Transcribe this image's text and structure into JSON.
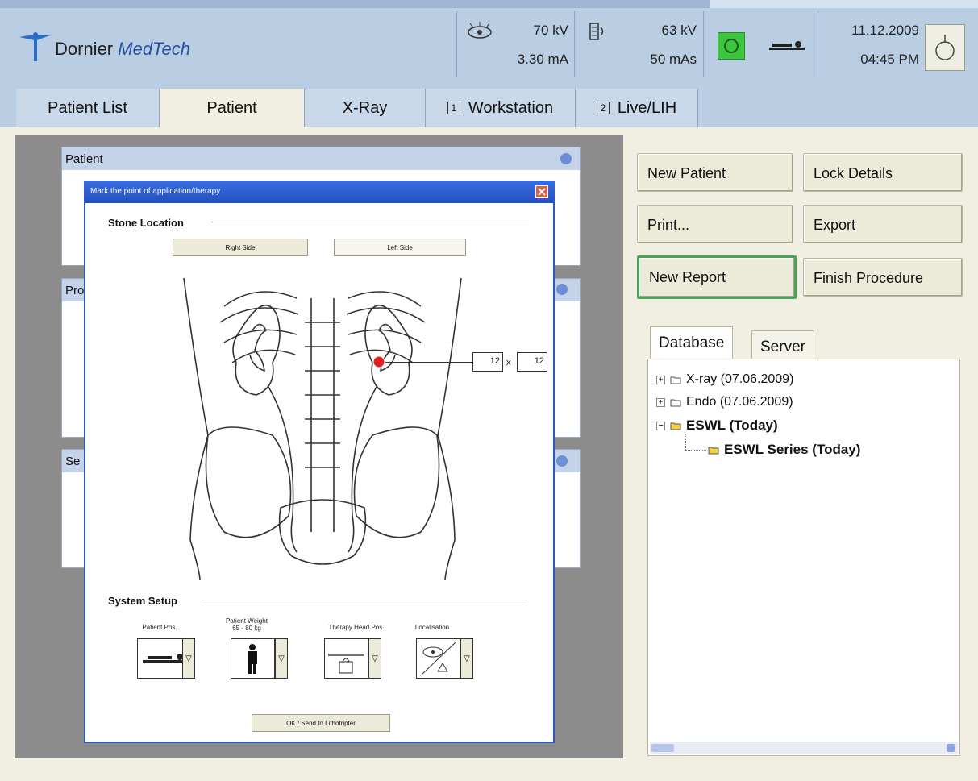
{
  "header": {
    "brand_part1": "Dornier",
    "brand_part2": "MedTech",
    "kv1": "70 kV",
    "ma": "3.30 mA",
    "kv2": "63 kV",
    "mas": "50 mAs",
    "date": "11.12.2009",
    "time": "04:45 PM"
  },
  "tabs": [
    {
      "label": "Patient List"
    },
    {
      "label": "Patient"
    },
    {
      "label": "X-Ray"
    },
    {
      "label": "Workstation",
      "num": "1"
    },
    {
      "label": "Live/LIH",
      "num": "2"
    }
  ],
  "bg_panels": {
    "patient": "Patient",
    "procedure_partial": "Pro",
    "series_partial": "Se"
  },
  "dialog": {
    "title": "Mark the point of application/therapy",
    "stone_location": "Stone Location",
    "right_side": "Right Side",
    "left_side": "Left Side",
    "size_w": "12",
    "size_x": "x",
    "size_h": "12",
    "system_setup": "System Setup",
    "patient_pos": "Patient Pos.",
    "patient_weight_line1": "Patient Weight",
    "patient_weight_line2": "65 - 80 kg",
    "therapy_head_pos": "Therapy Head Pos.",
    "localisation": "Localisation",
    "ok_button": "OK / Send to Lithotripter"
  },
  "actions": {
    "new_patient": "New Patient",
    "lock_details": "Lock Details",
    "print": "Print...",
    "export": "Export",
    "new_report": "New Report",
    "finish_procedure": "Finish Procedure"
  },
  "db_tabs": {
    "database": "Database",
    "server": "Server"
  },
  "tree": [
    {
      "label": "X-ray (07.06.2009)"
    },
    {
      "label": "Endo (07.06.2009)"
    },
    {
      "label": "ESWL (Today)"
    },
    {
      "label": "ESWL Series (Today)"
    }
  ],
  "colors": {
    "header_bg": "#b9cde3",
    "ok_status": "#3ec43e",
    "stone_marker": "#e02020",
    "highlight_border": "#4aa35d"
  }
}
